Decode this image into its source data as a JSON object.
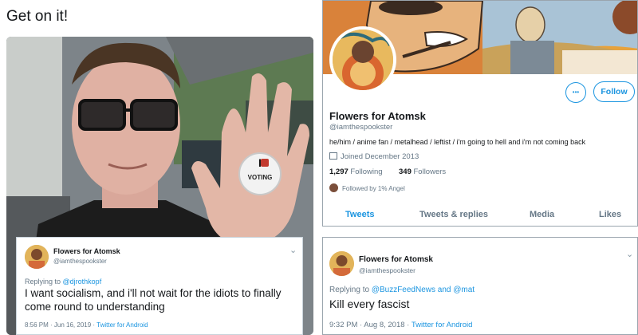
{
  "left": {
    "caption": "Get on it!",
    "photo_pin_top": "I",
    "photo_pin_bottom": "VOTING",
    "tweet": {
      "name": "Flowers for Atomsk",
      "handle": "@iamthespookster",
      "replying_prefix": "Replying to ",
      "replying_to": "@djrothkopf",
      "text": "I want socialism, and i'll not wait for the idiots to finally come round to understanding",
      "time": "8:56 PM · Jun 16, 2019 · ",
      "source": "Twitter for Android"
    }
  },
  "profile": {
    "name": "Flowers for Atomsk",
    "handle": "@iamthespookster",
    "bio": "he/him / anime fan / metalhead / leftist / i'm going to hell and i'm not coming back",
    "joined": "Joined December 2013",
    "following_count": "1,297",
    "following_label": "Following",
    "followers_count": "349",
    "followers_label": "Followers",
    "followed_by": "Followed by 1% Angel",
    "more_label": "•••",
    "follow_label": "Follow",
    "tabs": [
      "Tweets",
      "Tweets & replies",
      "Media",
      "Likes"
    ]
  },
  "right_tweet": {
    "name": "Flowers for Atomsk",
    "handle": "@iamthespookster",
    "replying_prefix": "Replying to ",
    "replying_to": "@BuzzFeedNews and @mat",
    "text": "Kill every fascist",
    "time": "9:32 PM · Aug 8, 2018 · ",
    "source": "Twitter for Android"
  },
  "colors": {
    "accent": "#1b95e0",
    "muted": "#657786",
    "text": "#14171a"
  }
}
